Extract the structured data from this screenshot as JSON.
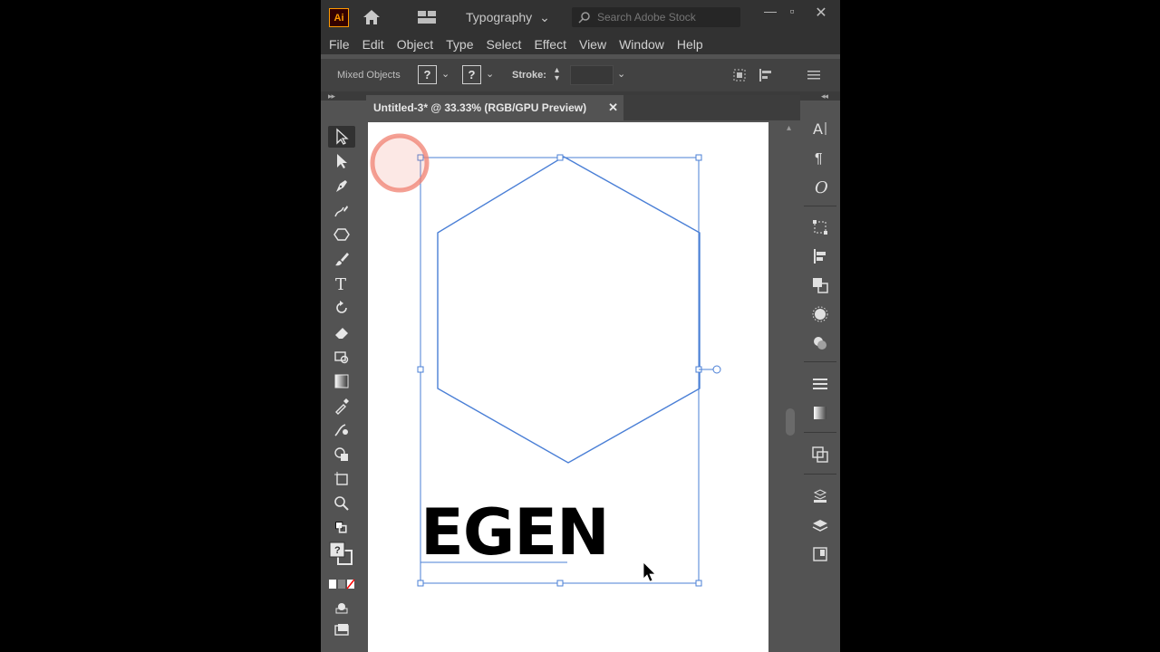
{
  "app": {
    "logo": "Ai"
  },
  "titlebar": {
    "workspace": "Typography",
    "search_placeholder": "Search Adobe Stock"
  },
  "menu": [
    "File",
    "Edit",
    "Object",
    "Type",
    "Select",
    "Effect",
    "View",
    "Window",
    "Help"
  ],
  "control": {
    "selection_label": "Mixed Objects",
    "fill_value": "?",
    "stroke_value": "?",
    "stroke_label": "Stroke:"
  },
  "document": {
    "tab_title": "Untitled-3* @ 33.33% (RGB/GPU Preview)"
  },
  "artwork": {
    "text": "EGEN"
  },
  "colors": {
    "accent": "#ff9a00",
    "selection": "#4a7fd6",
    "click_indicator": "#f08070"
  }
}
